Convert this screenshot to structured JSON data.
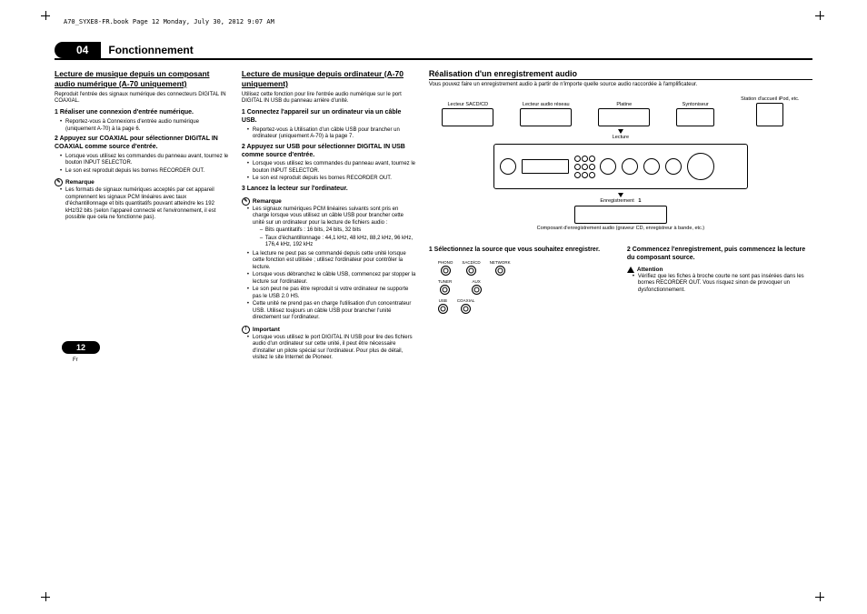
{
  "header": "A70_SYXE8-FR.book  Page 12  Monday, July 30, 2012  9:07 AM",
  "chapter": {
    "num": "04",
    "title": "Fonctionnement"
  },
  "col1": {
    "h": "Lecture de musique depuis un composant audio numérique (A-70 uniquement)",
    "intro": "Reproduit l'entrée des signaux numérique des connecteurs DIGITAL IN COAXIAL.",
    "s1": "1   Réaliser une connexion d'entrée numérique.",
    "s1b": "Reportez-vous à Connexions d'entrée audio numérique (uniquement A-70) à la page 6.",
    "s2": "2   Appuyez sur COAXIAL pour sélectionner DIGITAL IN COAXIAL comme source d'entrée.",
    "s2b1": "Lorsque vous utilisez les commandes du panneau avant, tournez le bouton INPUT SELECTOR.",
    "s2b2": "Le son est reproduit depuis les bornes RECORDER OUT.",
    "note": "Remarque",
    "n1": "Les formats de signaux numériques acceptés par cet appareil comprennent les signaux PCM linéaires avec taux d'échantillonnage et bits quantitatifs pouvant atteindre les 192 kHz/32 bits (selon l'appareil connecté et l'environnement, il est possible que cela ne fonctionne pas)."
  },
  "col2": {
    "h": "Lecture de musique depuis ordinateur (A-70 uniquement)",
    "intro": "Utilisez cette fonction pour lire l'entrée audio numérique sur le port DIGITAL IN USB du panneau arrière d'unité.",
    "s1": "1   Connectez l'appareil sur un ordinateur via un câble USB.",
    "s1b": "Reportez-vous à Utilisation d'un câble USB pour brancher un ordinateur (uniquement A-70) à la page 7.",
    "s2": "2   Appuyez sur USB pour sélectionner DIGITAL IN USB comme source d'entrée.",
    "s2b1": "Lorsque vous utilisez les commandes du panneau avant, tournez le bouton INPUT SELECTOR.",
    "s2b2": "Le son est reproduit depuis les bornes RECORDER OUT.",
    "s3": "3   Lancez la lecteur sur l'ordinateur.",
    "note": "Remarque",
    "n1": "Les signaux numériques PCM linéaires suivants sont pris en charge lorsque vous utilisez un câble USB pour brancher cette unité sur un ordinateur pour la lecture de fichiers audio :",
    "n1a": "Bits quantitatifs : 16 bits, 24 bits, 32 bits",
    "n1b": "Taux d'échantillonnage : 44,1 kHz, 48 kHz, 88,2 kHz, 96 kHz, 176,4 kHz, 192 kHz",
    "n2": "La lecture ne peut pas se commandé depuis cette unité lorsque cette fonction est utilisée ; utilisez l'ordinateur pour contrôler la lecture.",
    "n3": "Lorsque vous débranchez le câble USB, commencez par stopper la lecture sur l'ordinateur.",
    "n4": "Le son peut ne pas être reproduit si votre ordinateur ne supporte pas le USB 2.0 HS.",
    "n5": "Cette unité ne prend pas en charge l'utilisation d'un concentrateur USB. Utilisez toujours un câble USB pour brancher l'unité directement sur l'ordinateur.",
    "imp": "Important",
    "impb": "Lorsque vous utilisez le port DIGITAL IN USB pour lire des fichiers audio d'un ordinateur sur cette unité, il peut être nécessaire d'installer un pilote spécial sur l'ordinateur. Pour plus de détail, visitez le site Internet de Pioneer."
  },
  "col3": {
    "h": "Réalisation d'un enregistrement audio",
    "intro": "Vous pouvez faire un enregistrement audio à partir de n'importe quelle source audio raccordée à l'amplificateur.",
    "diag": {
      "sacd": "Lecteur SACD/CD",
      "net": "Lecteur audio réseau",
      "platine": "Platine",
      "tuner": "Syntoniseur",
      "ipod": "Station d'accueil iPod, etc.",
      "lecture": "Lecture",
      "enreg": "Enregistrement",
      "one": "1",
      "rec": "Composant d'enregistrement audio (graveur CD, enregistreur à bande, etc.)"
    },
    "s1": "1   Sélectionnez la source que vous souhaitez enregistrer.",
    "sel": {
      "phono": "PHONO",
      "sacd": "SACD/CD",
      "network": "NETWORK",
      "tuner": "TUNER",
      "aux": "AUX",
      "usb": "USB",
      "coax": "COAXIAL"
    },
    "s2": "2   Commencez l'enregistrement, puis commencez la lecture du composant source.",
    "att": "Attention",
    "attb": "Vérifiez que les fiches à broche courte ne sont pas insérées dans les bornes RECORDER OUT. Vous risquez sinon de provoquer un dysfonctionnement."
  },
  "footer": {
    "page": "12",
    "lang": "Fr"
  }
}
